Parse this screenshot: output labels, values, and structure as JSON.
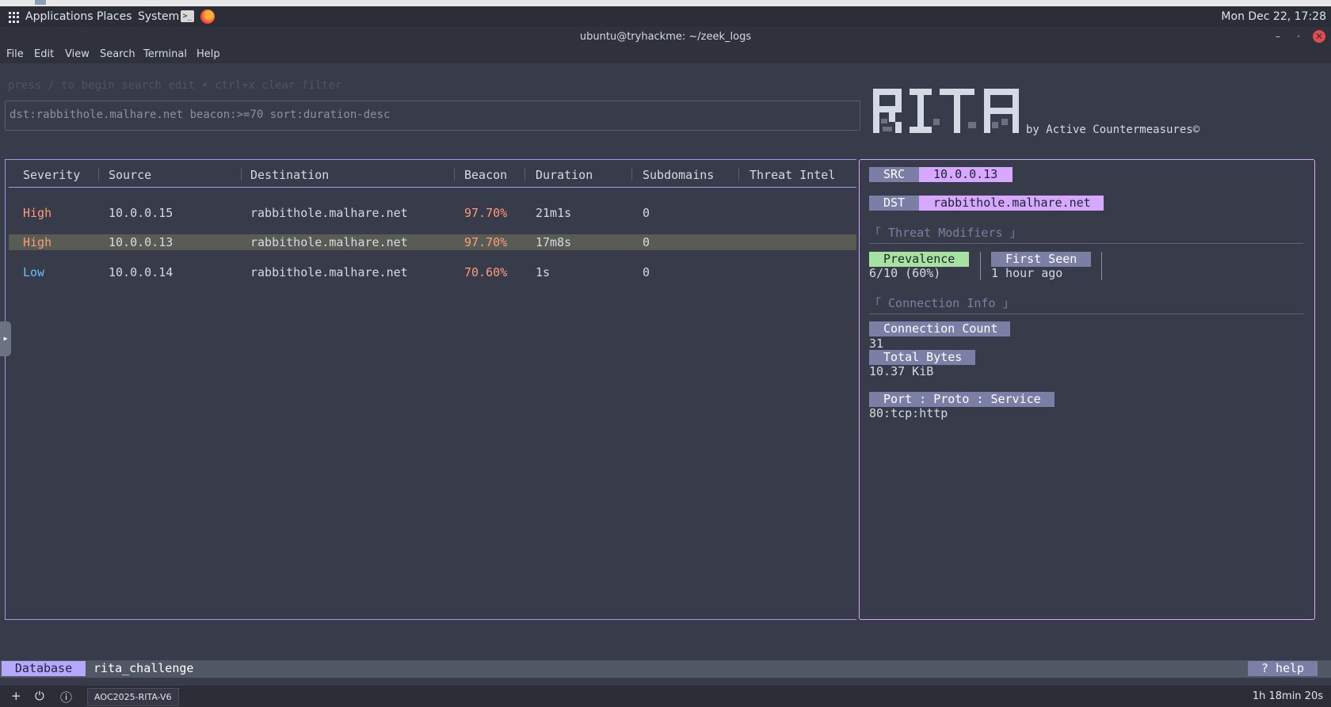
{
  "panel": {
    "applications": "Applications",
    "places": "Places",
    "system": "System",
    "terminal_glyph": ">_",
    "clock": "Mon Dec 22, 17:28"
  },
  "window": {
    "title": "ubuntu@tryhackme: ~/zeek_logs",
    "minimize_glyph": "–",
    "maximize_glyph": "·",
    "close_glyph": "✕"
  },
  "menu": [
    "File",
    "Edit",
    "View",
    "Search",
    "Terminal",
    "Help"
  ],
  "search": {
    "hint": "press / to begin search edit • ctrl+x clear filter",
    "filter": "dst:rabbithole.malhare.net beacon:>=70 sort:duration-desc"
  },
  "logo": {
    "text": "RITA",
    "tagline": "by Active Countermeasures©"
  },
  "table": {
    "headers": [
      "Severity",
      "Source",
      "Destination",
      "Beacon",
      "Duration",
      "Subdomains",
      "Threat Intel"
    ],
    "rows": [
      {
        "severity": "High",
        "source": "10.0.0.15",
        "destination": "rabbithole.malhare.net",
        "beacon": "97.70%",
        "duration": "21m1s",
        "subdomains": "0",
        "threat_intel": ""
      },
      {
        "severity": "High",
        "source": "10.0.0.13",
        "destination": "rabbithole.malhare.net",
        "beacon": "97.70%",
        "duration": "17m8s",
        "subdomains": "0",
        "threat_intel": ""
      },
      {
        "severity": "Low",
        "source": "10.0.0.14",
        "destination": "rabbithole.malhare.net",
        "beacon": "70.60%",
        "duration": "1s",
        "subdomains": "0",
        "threat_intel": ""
      }
    ],
    "selected_row": 1
  },
  "detail": {
    "src_label": "SRC",
    "src_value": "10.0.0.13",
    "dst_label": "DST",
    "dst_value": "rabbithole.malhare.net",
    "threat_modifiers_title": "「  Threat Modifiers 」",
    "prevalence_label": "Prevalence",
    "prevalence_value": "6/10 (60%)",
    "first_seen_label": "First Seen",
    "first_seen_value": "1 hour ago",
    "connection_info_title": "「  Connection Info 」",
    "connection_count_label": "Connection Count",
    "connection_count_value": "31",
    "total_bytes_label": "Total Bytes",
    "total_bytes_value": "10.37 KiB",
    "port_label": "Port : Proto : Service",
    "port_value": "80:tcp:http"
  },
  "statusbar": {
    "db_label": "Database",
    "db_value": "rita_challenge",
    "help": "? help"
  },
  "taskbar": {
    "add_glyph": "+",
    "power_glyph": "⏻",
    "info_glyph": "ⓘ",
    "window_label": "AOC2025-RITA-V6",
    "timer": "1h 18min 20s"
  },
  "colors": {
    "severity_high": "#ff9a77",
    "severity_low": "#5ec4f6",
    "accent_table_border": "#9d9be8",
    "accent_detail_border": "#d3a6ff",
    "highlight_value": "#d7a8ff",
    "prevalence_bg": "#a6e3a1"
  }
}
